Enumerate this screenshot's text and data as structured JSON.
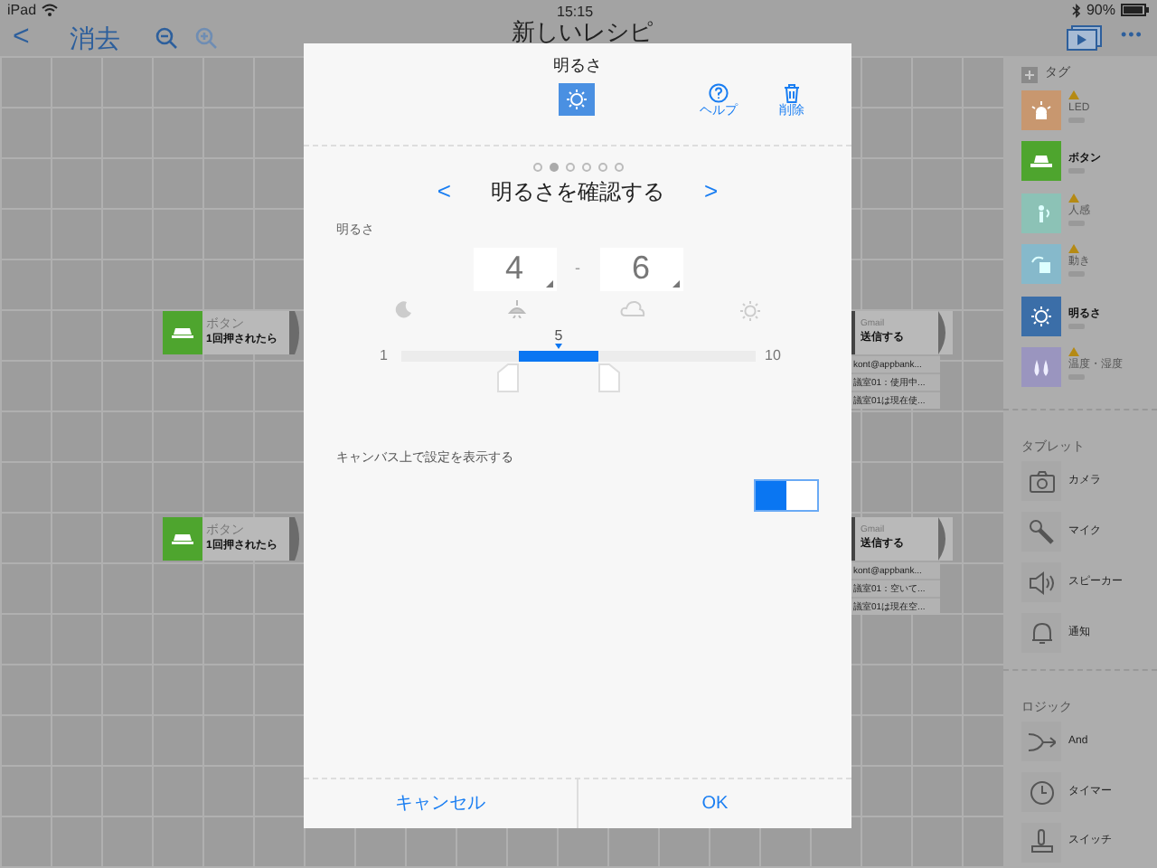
{
  "status_bar": {
    "device": "iPad",
    "time": "15:15",
    "battery": "90%"
  },
  "nav": {
    "back": "<",
    "clear": "消去",
    "title": "新しいレシピ",
    "more": "•••"
  },
  "canvas": {
    "nodes": [
      {
        "kind": "trigger",
        "label": "ボタン",
        "text": "1回押されたら"
      },
      {
        "kind": "trigger",
        "label": "ボタン",
        "text": "1回押されたら"
      },
      {
        "kind": "action",
        "label": "Gmail",
        "text": "送信する",
        "lines": [
          "kont@appbank...",
          "議室01：使用中...",
          "議室01は現在使..."
        ]
      },
      {
        "kind": "action",
        "label": "Gmail",
        "text": "送信する",
        "lines": [
          "kont@appbank...",
          "議室01：空いて...",
          "議室01は現在空..."
        ]
      }
    ]
  },
  "sidebar": {
    "tags_header": "タグ",
    "tags": [
      {
        "label": "LED",
        "color": "#c8976f",
        "warning": true
      },
      {
        "label": "ボタン",
        "color": "#4ea52e",
        "warning": false
      },
      {
        "label": "人感",
        "color": "#8cc2b6",
        "warning": true
      },
      {
        "label": "動き",
        "color": "#86b9cb",
        "warning": true
      },
      {
        "label": "明るさ",
        "color": "#3b6ea8",
        "warning": false
      },
      {
        "label": "温度・湿度",
        "color": "#9a95bf",
        "warning": true
      }
    ],
    "sections": [
      {
        "title": "タブレット",
        "items": [
          "カメラ",
          "マイク",
          "スピーカー",
          "通知"
        ]
      },
      {
        "title": "ロジック",
        "items": [
          "And",
          "タイマー",
          "スイッチ"
        ]
      }
    ]
  },
  "dialog": {
    "title": "明るさ",
    "help": "ヘルプ",
    "delete": "削除",
    "pages": [
      {
        "selected": false
      },
      {
        "selected": true
      },
      {
        "selected": false
      },
      {
        "selected": false
      },
      {
        "selected": false
      },
      {
        "selected": false
      }
    ],
    "prev": "<",
    "heading": "明るさを確認する",
    "next": ">",
    "field_label": "明るさ",
    "min_value": "4",
    "separator": "-",
    "max_value": "6",
    "slider": {
      "min": "1",
      "max": "10",
      "current": "5",
      "current_marker": {
        "level": 0.444
      },
      "handles": [
        {
          "level": 0.333
        },
        {
          "level": 0.556
        }
      ]
    },
    "toggle_label": "キャンバス上で設定を表示する",
    "toggle": {
      "on": true
    },
    "buttons": [
      "キャンセル",
      "OK"
    ]
  }
}
